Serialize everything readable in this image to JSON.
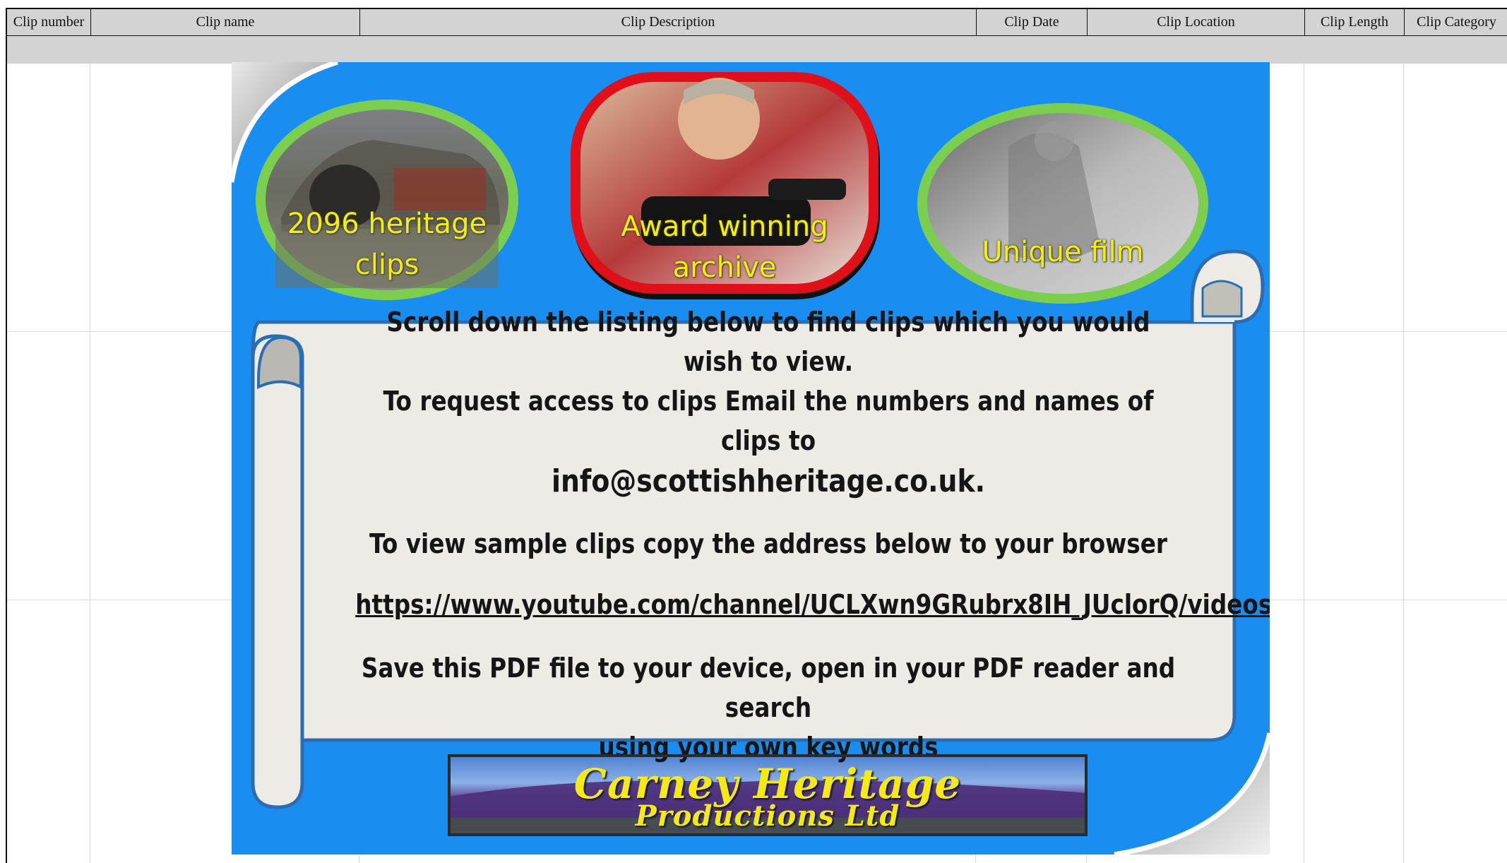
{
  "table": {
    "columns": [
      {
        "key": "number",
        "label": "Clip number"
      },
      {
        "key": "name",
        "label": "Clip name"
      },
      {
        "key": "description",
        "label": "Clip Description"
      },
      {
        "key": "date",
        "label": "Clip Date"
      },
      {
        "key": "location",
        "label": "Clip Location"
      },
      {
        "key": "length",
        "label": "Clip Length"
      },
      {
        "key": "category",
        "label": "Clip Category"
      }
    ]
  },
  "banner": {
    "badges": [
      {
        "line1": "2096 heritage",
        "line2": "clips"
      },
      {
        "line1": "Award winning",
        "line2": "archive"
      },
      {
        "line1": "Unique film",
        "line2": ""
      }
    ],
    "notice": {
      "line1": "Scroll down the listing below to find clips which you would wish to view.",
      "line2": "To request access to clips Email the numbers and names of clips to",
      "email": "info@scottishheritage.co.uk.",
      "sample": "To view sample clips copy the address below to your browser",
      "url": "https://www.youtube.com/channel/UCLXwn9GRubrx8IH_JUclorQ/videos",
      "save1": "Save this PDF file to your device, open in your PDF reader and search",
      "save2": "using your own key words"
    },
    "logo": {
      "line1": "Carney Heritage",
      "line2": "Productions Ltd"
    },
    "colors": {
      "background": "#1a8ef0",
      "scroll": "#ecebe6",
      "scroll_edge": "#2b6db3",
      "badge_green": "#7ccf4e",
      "badge_red": "#e0101a",
      "text_yellow": "#f4f000"
    }
  }
}
